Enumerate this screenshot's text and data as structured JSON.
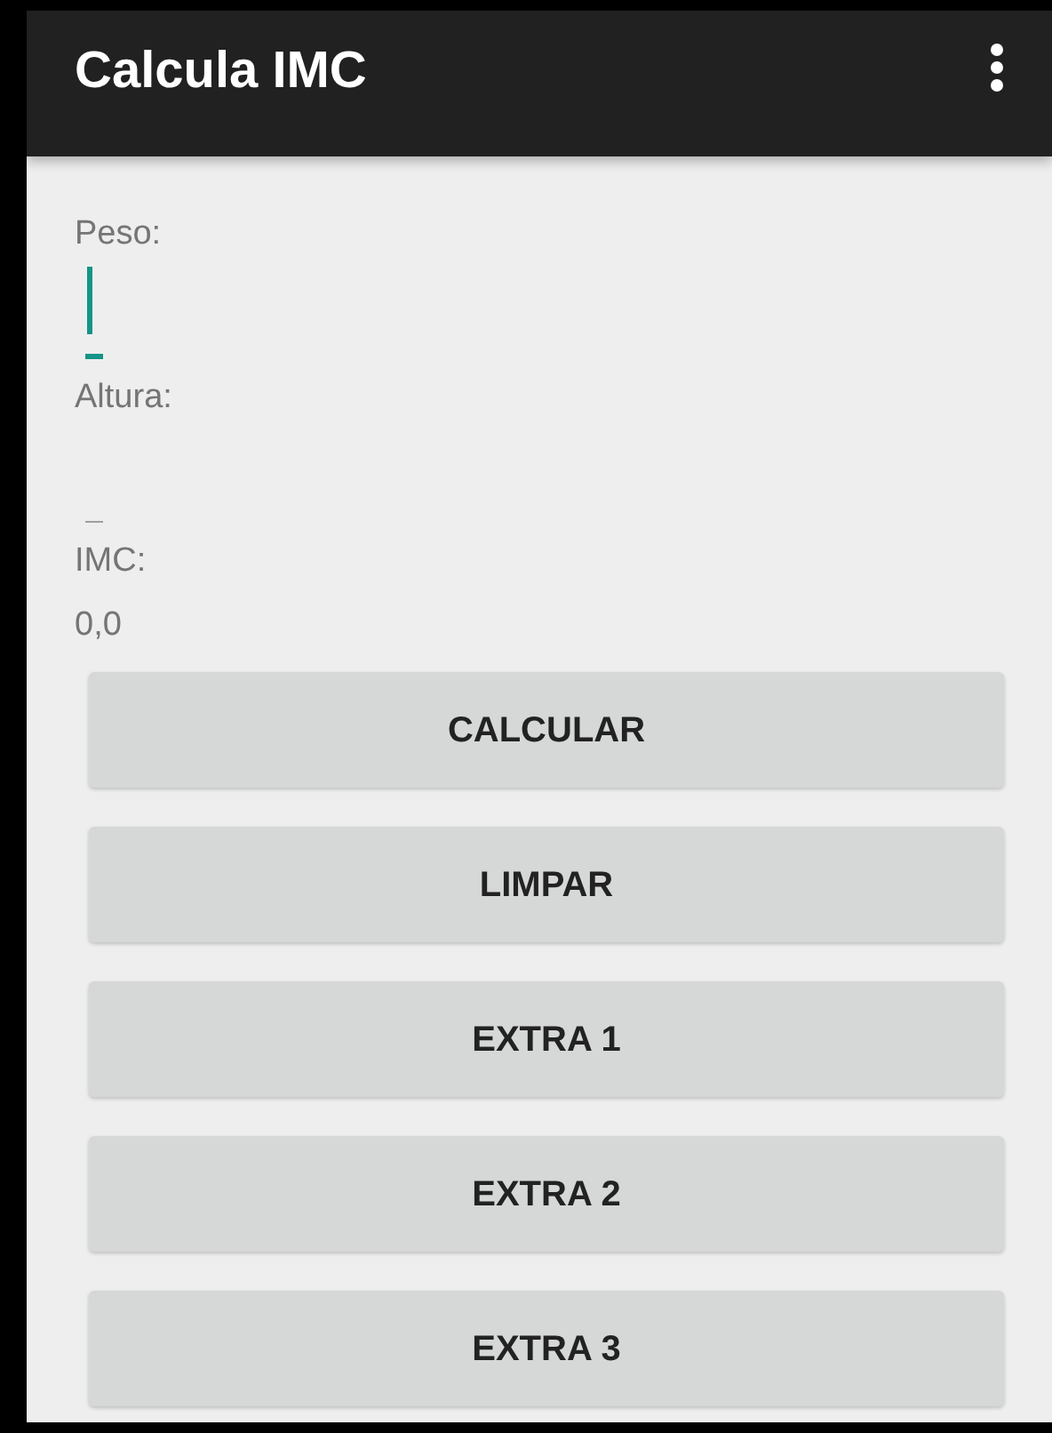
{
  "app_bar": {
    "title": "Calcula IMC"
  },
  "form": [
    {
      "kind": "field",
      "label": "Peso:",
      "focused": true
    },
    {
      "kind": "field",
      "label": "Altura:",
      "focused": false
    },
    {
      "kind": "output",
      "label": "IMC:",
      "value": "0,0"
    }
  ],
  "buttons": [
    "CALCULAR",
    "LIMPAR",
    "EXTRA 1",
    "EXTRA 2",
    "EXTRA 3"
  ]
}
